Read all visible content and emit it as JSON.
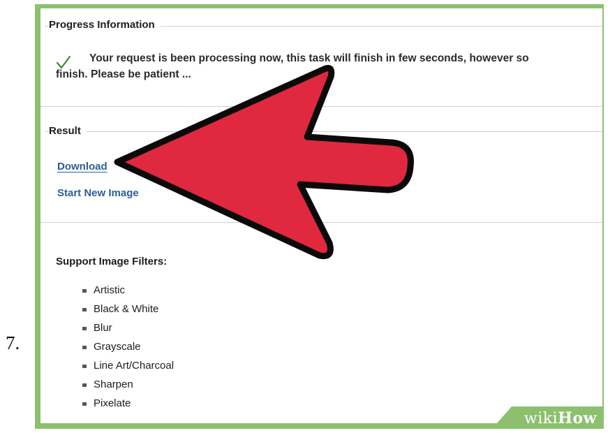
{
  "step_number": "7.",
  "progress": {
    "legend": "Progress Information",
    "message_line1": "Your request is been processing now, this task will finish in few seconds, however so",
    "message_line2": "finish. Please be patient ..."
  },
  "result": {
    "legend": "Result",
    "download_label": "Download",
    "start_new_label": "Start New Image"
  },
  "filters": {
    "title": "Support Image Filters:",
    "items": [
      "Artistic",
      "Black & White",
      "Blur",
      "Grayscale",
      "Line Art/Charcoal",
      "Sharpen",
      "Pixelate"
    ]
  },
  "watermark": {
    "wiki": "wiki",
    "how": "How"
  },
  "colors": {
    "frame_green": "#8cc06e",
    "arrow_red": "#e0283f",
    "link_blue": "#2b5f94",
    "check_green": "#3a8a3a"
  },
  "icons": [
    "check-icon",
    "arrow-annotation"
  ]
}
